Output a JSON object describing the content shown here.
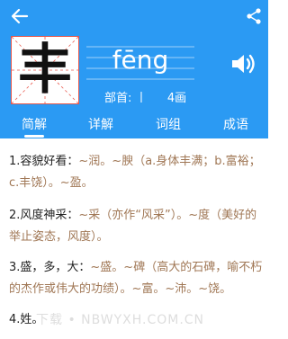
{
  "header": {
    "character": "丰",
    "pinyin": "fēng",
    "radical_label": "部首:",
    "radical_value": "丨",
    "strokes": "4画",
    "colors": {
      "header_bg": "#2b9af3",
      "char_border": "#e8584c",
      "definition_text": "#a07755"
    }
  },
  "icons": {
    "back": "back-arrow-icon",
    "share": "share-icon",
    "speaker": "speaker-icon"
  },
  "tabs": [
    {
      "label": "简解",
      "active": true
    },
    {
      "label": "详解",
      "active": false
    },
    {
      "label": "词组",
      "active": false
    },
    {
      "label": "成语",
      "active": false
    }
  ],
  "definitions": [
    {
      "head": "1.容貌好看：",
      "body": "~润。~腴（a.身体丰满；b.富裕；c.丰饶）。~盈。"
    },
    {
      "head": "2.风度神采：",
      "body": "~采（亦作“风采”）。~度（美好的举止姿态，风度）。"
    },
    {
      "head": "3.盛，多，大：",
      "body": "~盛。~碑（高大的石碑，喻不朽的杰作或伟大的功绩）。~富。~沛。~饶。"
    },
    {
      "head": "4.姓。",
      "body": ""
    }
  ],
  "watermark": "下载 • NBWYXH.COM.CN"
}
